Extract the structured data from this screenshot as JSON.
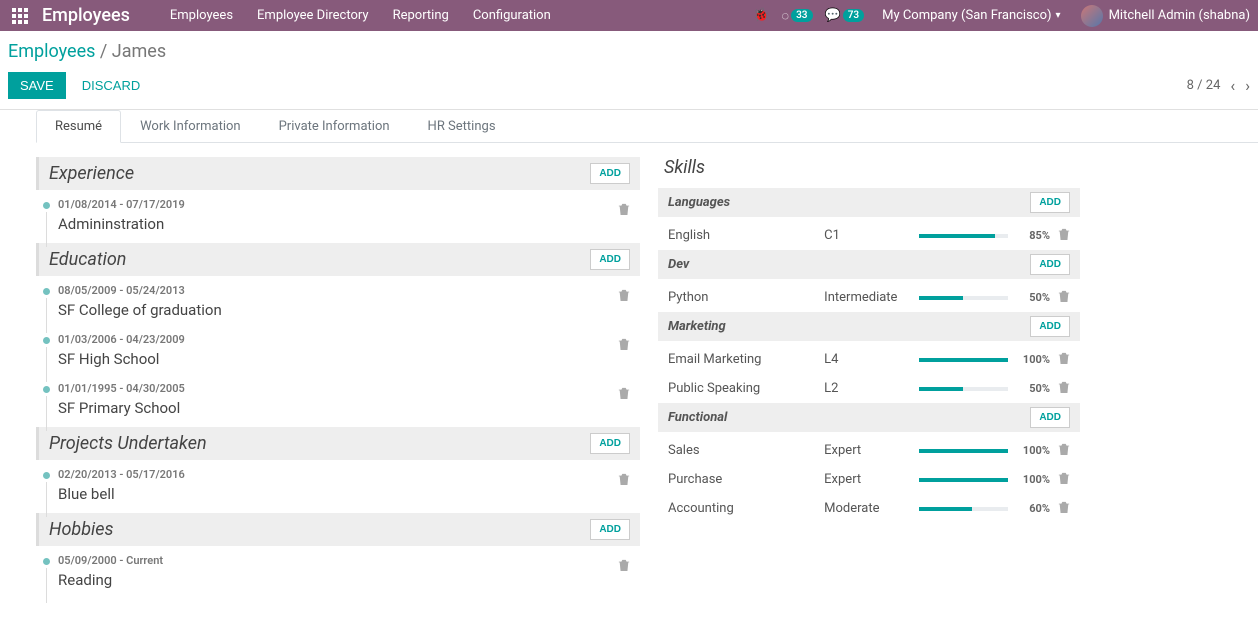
{
  "app": {
    "brand": "Employees",
    "nav": [
      "Employees",
      "Employee Directory",
      "Reporting",
      "Configuration"
    ],
    "badges": {
      "c": "33",
      "chat": "73"
    },
    "company": "My Company (San Francisco)",
    "user": "Mitchell Admin (shabna)"
  },
  "breadcrumb": {
    "root": "Employees",
    "current": "James"
  },
  "actions": {
    "save": "SAVE",
    "discard": "DISCARD",
    "pager": "8 / 24"
  },
  "tabs": [
    "Resumé",
    "Work Information",
    "Private Information",
    "HR Settings"
  ],
  "add_label": "ADD",
  "resume": [
    {
      "title": "Experience",
      "items": [
        {
          "dates": "01/08/2014 - 07/17/2019",
          "title": "Admininstration"
        }
      ]
    },
    {
      "title": "Education",
      "items": [
        {
          "dates": "08/05/2009 - 05/24/2013",
          "title": "SF College of graduation"
        },
        {
          "dates": "01/03/2006 - 04/23/2009",
          "title": "SF High School"
        },
        {
          "dates": "01/01/1995 - 04/30/2005",
          "title": "SF Primary School"
        }
      ]
    },
    {
      "title": "Projects Undertaken",
      "items": [
        {
          "dates": "02/20/2013 - 05/17/2016",
          "title": "Blue bell"
        }
      ]
    },
    {
      "title": "Hobbies",
      "items": [
        {
          "dates": "05/09/2000 - Current",
          "title": "Reading"
        }
      ]
    }
  ],
  "skills_heading": "Skills",
  "skills": [
    {
      "group": "Languages",
      "items": [
        {
          "name": "English",
          "level": "C1",
          "pct": 85
        }
      ]
    },
    {
      "group": "Dev",
      "items": [
        {
          "name": "Python",
          "level": "Intermediate",
          "pct": 50
        }
      ]
    },
    {
      "group": "Marketing",
      "items": [
        {
          "name": "Email Marketing",
          "level": "L4",
          "pct": 100
        },
        {
          "name": "Public Speaking",
          "level": "L2",
          "pct": 50
        }
      ]
    },
    {
      "group": "Functional",
      "items": [
        {
          "name": "Sales",
          "level": "Expert",
          "pct": 100
        },
        {
          "name": "Purchase",
          "level": "Expert",
          "pct": 100
        },
        {
          "name": "Accounting",
          "level": "Moderate",
          "pct": 60
        }
      ]
    }
  ]
}
